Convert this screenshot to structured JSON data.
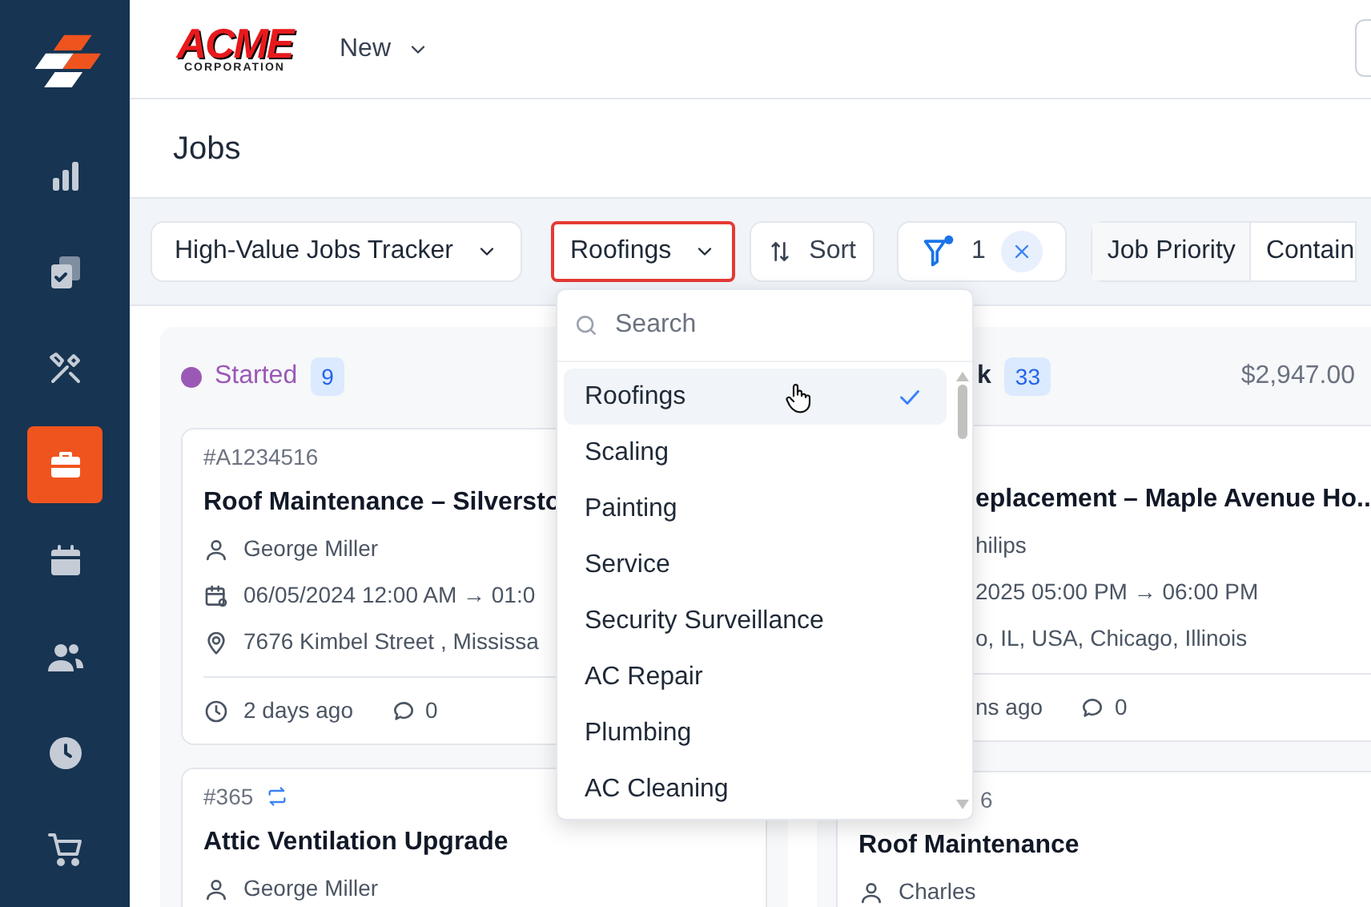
{
  "sidebar": {
    "items": [
      {
        "selected": false
      },
      {
        "selected": false
      },
      {
        "selected": false
      },
      {
        "selected": true
      },
      {
        "selected": false
      },
      {
        "selected": false
      },
      {
        "selected": false
      },
      {
        "selected": false
      }
    ]
  },
  "header": {
    "logo": {
      "title": "ACME",
      "subtitle": "CORPORATION"
    },
    "new_menu": "New"
  },
  "page_title": "Jobs",
  "toolbar": {
    "board_select": "High-Value Jobs Tracker",
    "category_select": {
      "value": "Roofings",
      "focused": true
    },
    "sort": "Sort",
    "filter": {
      "count": "1"
    },
    "condition": {
      "field": "Job Priority",
      "operator": "Contain"
    }
  },
  "dropdown": {
    "placeholder": "Search",
    "options": [
      {
        "label": "Roofings",
        "selected": true
      },
      {
        "label": "Scaling",
        "selected": false
      },
      {
        "label": "Painting",
        "selected": false
      },
      {
        "label": "Service",
        "selected": false
      },
      {
        "label": "Security Surveillance",
        "selected": false
      },
      {
        "label": "AC Repair",
        "selected": false
      },
      {
        "label": "Plumbing",
        "selected": false
      },
      {
        "label": "AC Cleaning",
        "selected": false
      }
    ]
  },
  "columns": [
    {
      "name": "Started",
      "color": "#9b59b6",
      "count": "9",
      "cards": [
        {
          "id": "#A1234516",
          "recurring": false,
          "title": "Roof Maintenance – Silversto",
          "assignee": "George Miller",
          "schedule": "06/05/2024 12:00 AM → 01:0",
          "address": "7676 Kimbel Street , Mississa",
          "age": "2 days ago",
          "comments": "0"
        },
        {
          "id": "#365",
          "recurring": true,
          "title": "Attic Ventilation Upgrade",
          "assignee": "George Miller"
        }
      ]
    },
    {
      "name": "k",
      "count": "33",
      "total": "$2,947.00",
      "cards": [
        {
          "title": "eplacement – Maple Avenue Ho...",
          "assignee": "hilips",
          "schedule": "2025 05:00 PM → 06:00 PM",
          "address": "o, IL, USA, Chicago, Illinois",
          "age": "ns ago",
          "comments": "0"
        },
        {
          "id": "6",
          "recurring": false,
          "title": "Roof Maintenance",
          "assignee": "Charles"
        }
      ]
    }
  ]
}
